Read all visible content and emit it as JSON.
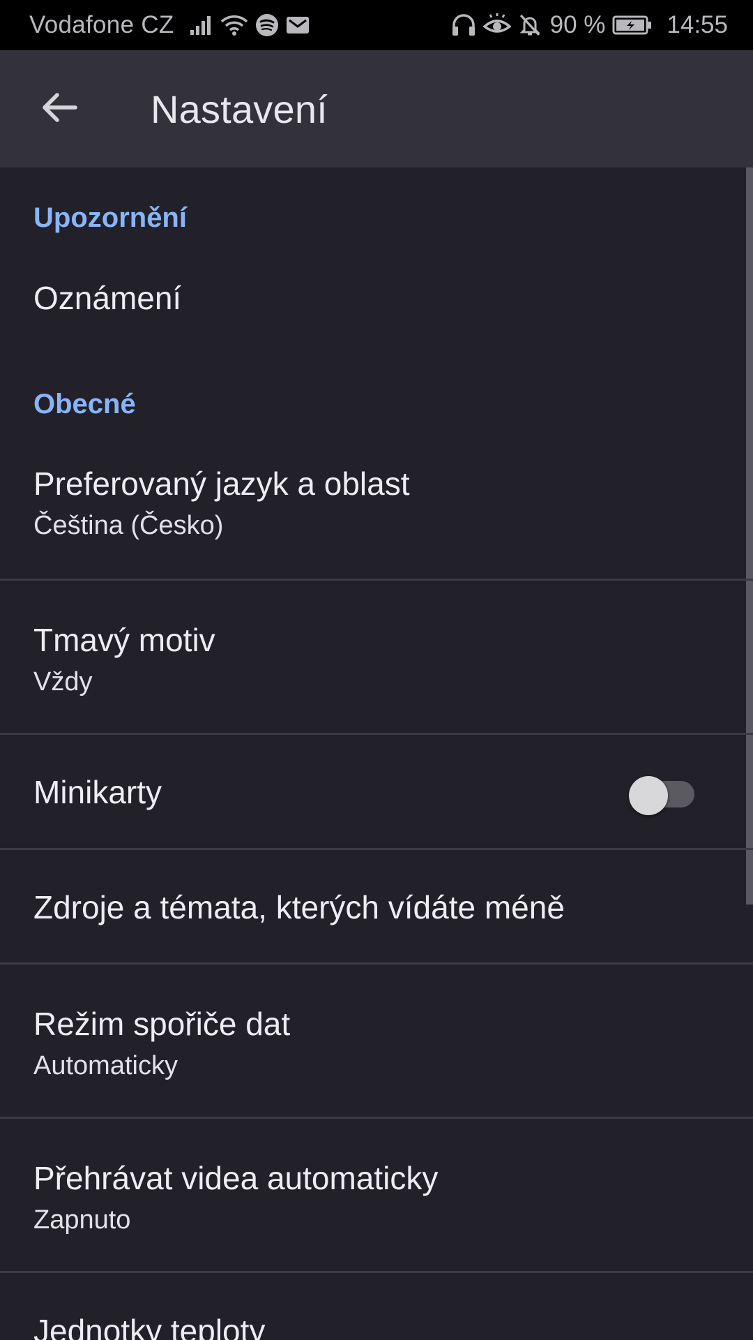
{
  "status_bar": {
    "carrier": "Vodafone CZ",
    "battery_percent": "90 %",
    "time": "14:55",
    "left_icons": [
      "signal-icon",
      "wifi-icon",
      "spotify-icon",
      "mail-icon"
    ],
    "right_icons": [
      "headphones-icon",
      "eye-icon",
      "bell-off-icon",
      "battery-icon"
    ]
  },
  "app_bar": {
    "back_icon": "arrow-back-icon",
    "title": "Nastavení"
  },
  "sections": {
    "notifications_header": "Upozornění",
    "general_header": "Obecné"
  },
  "prefs": {
    "notifications": {
      "title": "Oznámení"
    },
    "language": {
      "title": "Preferovaný jazyk a oblast",
      "summary": "Čeština (Česko)"
    },
    "dark_theme": {
      "title": "Tmavý motiv",
      "summary": "Vždy"
    },
    "minicards": {
      "title": "Minikarty",
      "toggle_on": false
    },
    "sources": {
      "title": "Zdroje a témata, kterých vídáte méně"
    },
    "data_saver": {
      "title": "Režim spořiče dat",
      "summary": "Automaticky"
    },
    "autoplay": {
      "title": "Přehrávat videa automaticky",
      "summary": "Zapnuto"
    },
    "temperature": {
      "title": "Jednotky teploty"
    }
  },
  "colors": {
    "background": "#222129",
    "app_bar": "#33323a",
    "accent": "#8ab4f8",
    "divider": "#3c3b43"
  }
}
